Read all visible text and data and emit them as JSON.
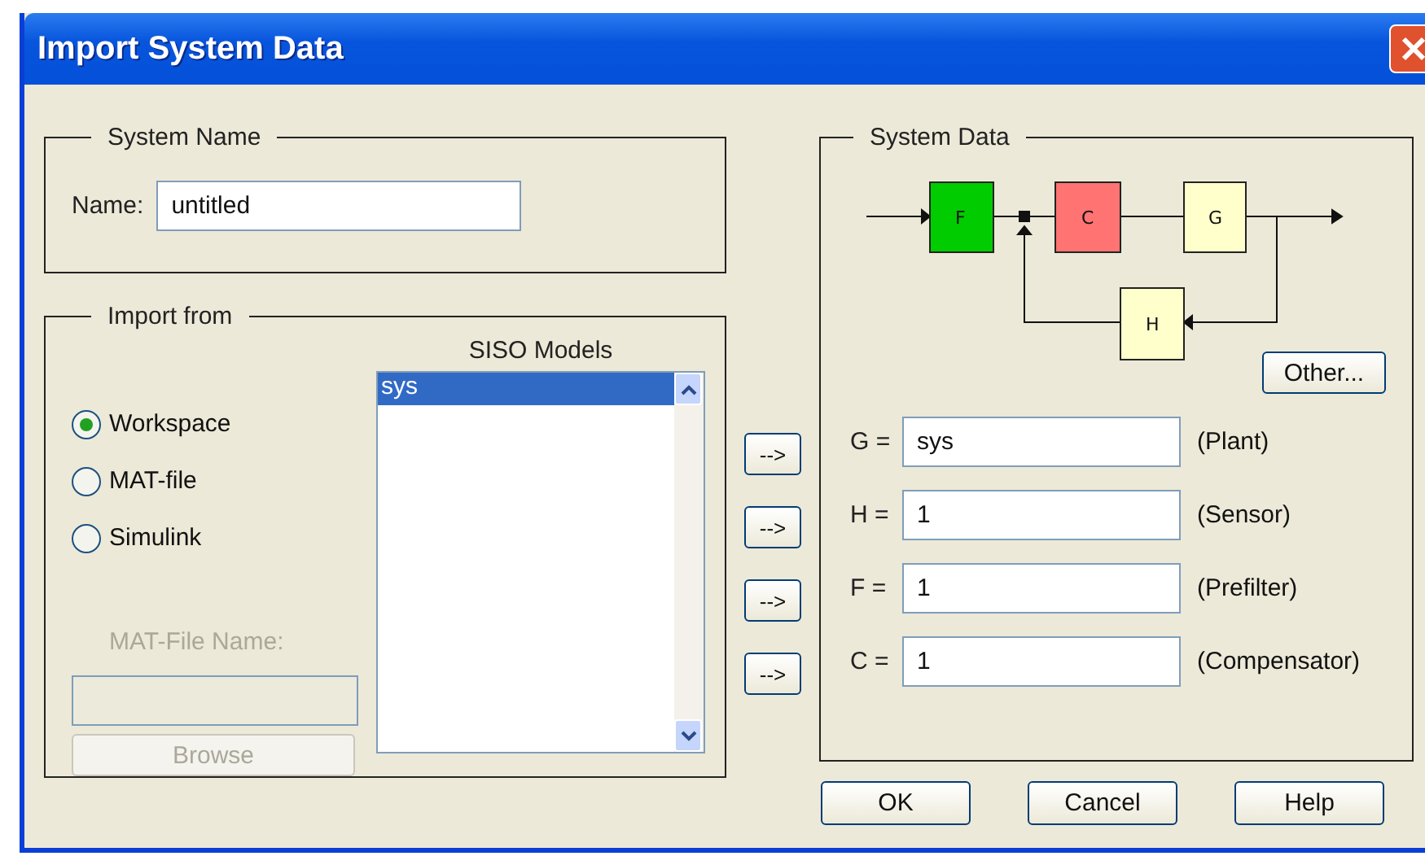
{
  "window": {
    "title": "Import System Data"
  },
  "system_name": {
    "legend": "System Name",
    "label": "Name:",
    "value": "untitled"
  },
  "import_from": {
    "legend": "Import from",
    "sources": [
      {
        "label": "Workspace",
        "selected": true
      },
      {
        "label": "MAT-file",
        "selected": false
      },
      {
        "label": "Simulink",
        "selected": false
      }
    ],
    "mat_file": {
      "label": "MAT-File Name:",
      "disabled": true,
      "browse": "Browse"
    },
    "models": {
      "heading": "SISO Models",
      "items": [
        {
          "label": "sys",
          "selected": true
        }
      ]
    }
  },
  "transfer_buttons": [
    "-->",
    "-->",
    "-->",
    "-->"
  ],
  "system_data": {
    "legend": "System Data",
    "diagram": {
      "blocks": [
        {
          "label": "F",
          "color": "#00cc00"
        },
        {
          "label": "C",
          "color": "#ff7373"
        },
        {
          "label": "G",
          "color": "#ffffcc"
        },
        {
          "label": "H",
          "color": "#ffffcc"
        }
      ]
    },
    "other_button": "Other...",
    "fields": [
      {
        "label": "G =",
        "value": "sys",
        "hint": "(Plant)"
      },
      {
        "label": "H =",
        "value": "1",
        "hint": "(Sensor)"
      },
      {
        "label": "F =",
        "value": "1",
        "hint": "(Prefilter)"
      },
      {
        "label": "C =",
        "value": "1",
        "hint": "(Compensator)"
      }
    ]
  },
  "buttons": [
    "OK",
    "Cancel",
    "Help"
  ]
}
